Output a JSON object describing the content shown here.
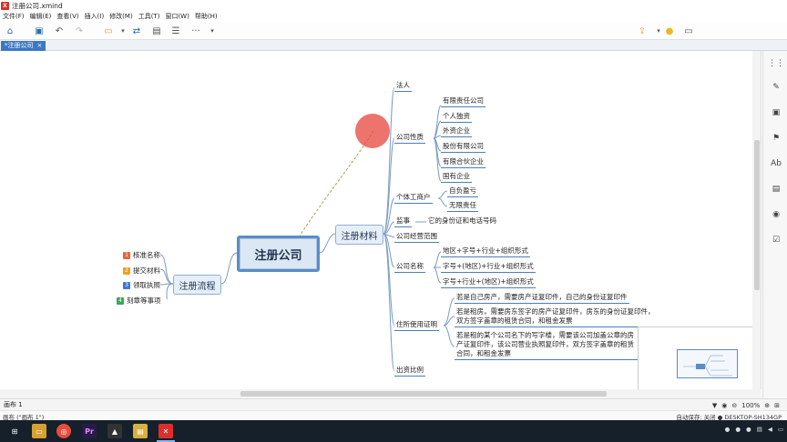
{
  "window": {
    "title": "注册公司.xmind",
    "app_icon_label": "X"
  },
  "menu": [
    "文件(F)",
    "编辑(E)",
    "查看(V)",
    "插入(I)",
    "修改(M)",
    "工具(T)",
    "窗口(W)",
    "帮助(H)"
  ],
  "toolbar": {
    "icons": [
      "home-icon",
      "save-icon",
      "undo-icon",
      "redo-icon",
      "insert-topic-icon",
      "swap-icon",
      "image-icon",
      "outline-icon",
      "more-icon",
      "export-icon",
      "bulb-icon",
      "presentation-icon"
    ],
    "more_label": "···"
  },
  "tab": {
    "label": "*注册公司",
    "close": "×"
  },
  "mindmap": {
    "central": "注册公司",
    "left_branch": {
      "label": "注册流程",
      "items": [
        {
          "num": "1",
          "label": "核准名称",
          "color": "#e8643c"
        },
        {
          "num": "2",
          "label": "提交材料",
          "color": "#f0a020"
        },
        {
          "num": "3",
          "label": "领取执照",
          "color": "#3a7bd5"
        },
        {
          "num": "4",
          "label": "刻章等事项",
          "color": "#3aa65a"
        }
      ]
    },
    "right_branch": {
      "label": "注册材料",
      "faren": "法人",
      "company_type": {
        "label": "公司性质",
        "items": [
          "有限责任公司",
          "个人独资",
          "外资企业",
          "股份有限公司",
          "有限合伙企业",
          "国有企业"
        ]
      },
      "individual": {
        "label": "个体工商户",
        "items": [
          "自负盈亏",
          "无限责任"
        ]
      },
      "supervisor": {
        "label": "监事",
        "detail": "它的身份证和电话号码"
      },
      "scope": "公司经营范围",
      "name": {
        "label": "公司名称",
        "items": [
          "地区+字号+行业+组织形式",
          "字号+(地区)+行业+组织形式",
          "字号+行业+(地区)+组织形式"
        ]
      },
      "residence": {
        "label": "住所使用证明",
        "items": [
          "若是自己房产，需要房产证复印件，自己的身份证复印件",
          "若是租房，需要房东签字的房产证复印件，房东的身份证复印件，双方签字盖章的租赁合同，和租金发票",
          "若是租的某个公司名下的写字楼，需要该公司加盖公章的房产证复印件，该公司营业执照复印件，双方签字盖章的租赁合同，和租金发票"
        ]
      },
      "capital": "出资比例"
    }
  },
  "sheet": {
    "label": "画布 1"
  },
  "zoom": {
    "level": "100%",
    "minus": "⊖",
    "plus": "⊕"
  },
  "status": {
    "left": "画布 (\"画布 1\")",
    "autosave": "自动保存: 关闭",
    "host": "DESKTOP-SH134GP"
  },
  "colors": {
    "accent": "#3c78c3",
    "topic_border": "#5b8cc7",
    "line": "#4a7fb5",
    "cursor": "#e5463c",
    "taskbar": "#15202b"
  },
  "taskbar_apps": [
    "start-icon",
    "folder-icon",
    "chrome-icon",
    "premiere-icon",
    "photos-icon",
    "explorer-icon",
    "xmind-icon"
  ],
  "premiere_label": "Pr"
}
